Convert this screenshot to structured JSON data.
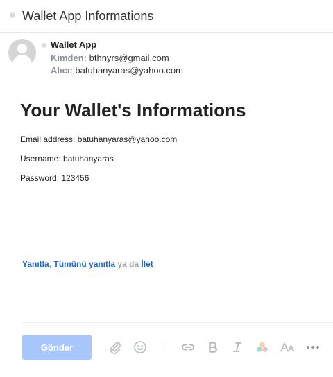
{
  "header": {
    "title": "Wallet App Informations"
  },
  "sender": {
    "name": "Wallet App",
    "from_label": "Kimden:",
    "from_value": "bthnyrs@gmail.com",
    "to_label": "Alıcı:",
    "to_value": "batuhanyaras@yahoo.com"
  },
  "message": {
    "title": "Your Wallet's Informations",
    "email_line": "Email address: batuhanyaras@yahoo.com",
    "username_line": "Username: batuhanyaras",
    "password_line": "Password: 123456"
  },
  "reply": {
    "reply_label": "Yanıtla",
    "comma": ",",
    "reply_all_label": "Tümünü yanıtla",
    "or_text": "ya da",
    "forward_label": "İlet"
  },
  "composer": {
    "send_label": "Gönder",
    "icons": [
      "attachment-icon",
      "emoji-icon",
      "link-icon",
      "bold-icon",
      "italic-icon",
      "color-icon",
      "font-size-icon",
      "more-icon"
    ]
  },
  "colors": {
    "accent": "#1a66d8",
    "send_button": "#a8c7fa",
    "icon": "#b5b9be"
  }
}
